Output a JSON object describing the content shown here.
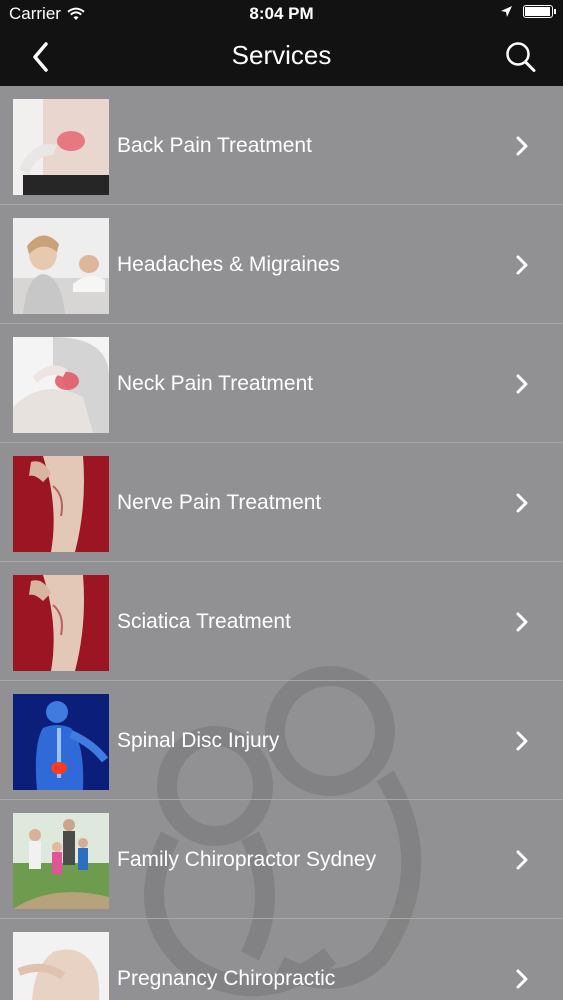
{
  "status_bar": {
    "carrier": "Carrier",
    "time": "8:04 PM",
    "battery_level": 0.95
  },
  "nav": {
    "title": "Services"
  },
  "colors": {
    "bar": "#121212",
    "list_bg": "#919193",
    "separator": "#a8a8aa",
    "text": "#ffffff"
  },
  "services": [
    {
      "label": "Back Pain Treatment",
      "thumbnail": "back-pain-photo"
    },
    {
      "label": "Headaches & Migraines",
      "thumbnail": "headache-photo"
    },
    {
      "label": "Neck Pain Treatment",
      "thumbnail": "neck-pain-photo"
    },
    {
      "label": "Nerve Pain Treatment",
      "thumbnail": "nerve-pain-photo"
    },
    {
      "label": "Sciatica Treatment",
      "thumbnail": "sciatica-photo"
    },
    {
      "label": "Spinal Disc Injury",
      "thumbnail": "spinal-disc-photo"
    },
    {
      "label": "Family Chiropractor Sydney",
      "thumbnail": "family-photo"
    },
    {
      "label": "Pregnancy Chiropractic",
      "thumbnail": "pregnancy-photo"
    }
  ]
}
